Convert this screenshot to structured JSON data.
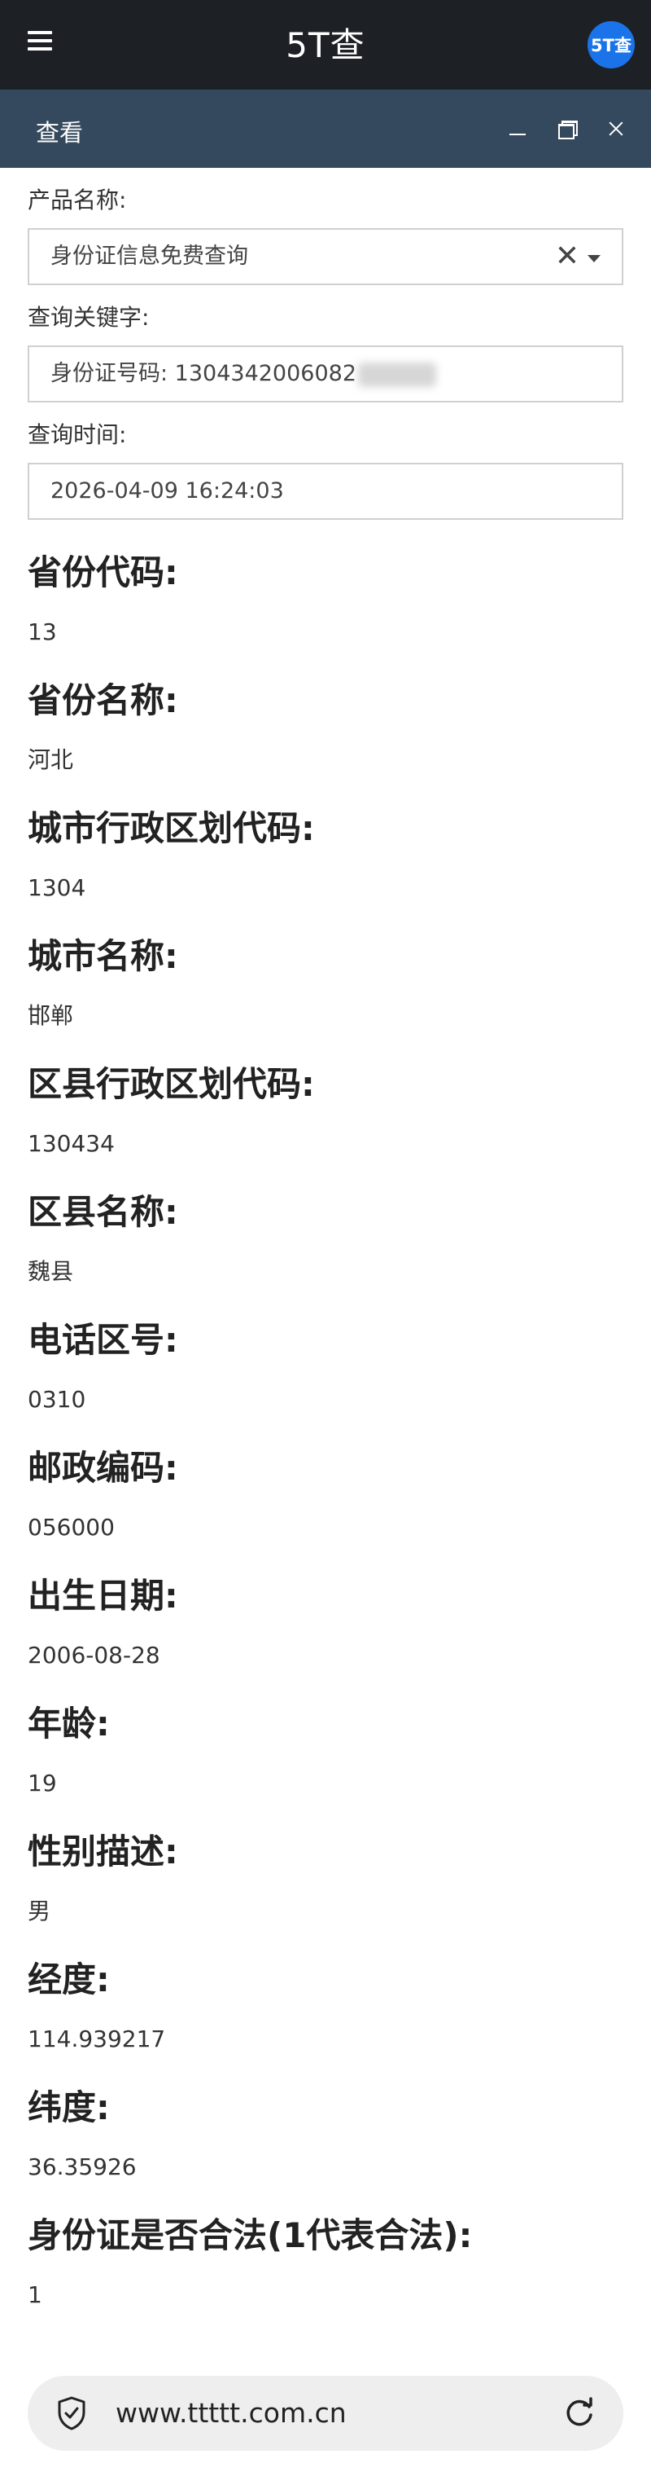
{
  "header": {
    "app_title": "5T查",
    "logo_text": "5T查",
    "menu_icon": "hamburger-menu-icon"
  },
  "window": {
    "title": "查看",
    "controls": [
      "minimize-icon",
      "maximize-icon",
      "close-icon"
    ]
  },
  "form": {
    "product_label": "产品名称:",
    "product_value": "身份证信息免费查询",
    "keyword_label": "查询关键字:",
    "keyword_value": "身份证号码: 1304342006082",
    "time_label": "查询时间:",
    "time_value": "2026-04-09 16:24:03"
  },
  "results": [
    {
      "label": "省份代码:",
      "value": "13"
    },
    {
      "label": "省份名称:",
      "value": "河北"
    },
    {
      "label": "城市行政区划代码:",
      "value": "1304"
    },
    {
      "label": "城市名称:",
      "value": "邯郸"
    },
    {
      "label": "区县行政区划代码:",
      "value": "130434"
    },
    {
      "label": "区县名称:",
      "value": "魏县"
    },
    {
      "label": "电话区号:",
      "value": "0310"
    },
    {
      "label": "邮政编码:",
      "value": "056000"
    },
    {
      "label": "出生日期:",
      "value": "2006-08-28"
    },
    {
      "label": "年龄:",
      "value": "19"
    },
    {
      "label": "性别描述:",
      "value": "男"
    },
    {
      "label": "经度:",
      "value": "114.939217"
    },
    {
      "label": "纬度:",
      "value": "36.35926"
    },
    {
      "label": "身份证是否合法(1代表合法):",
      "value": "1"
    }
  ],
  "browser": {
    "url": "www.ttttt.com.cn",
    "icons": [
      "shield-icon",
      "reload-icon"
    ]
  },
  "colors": {
    "topbar_bg": "#1d2126",
    "windowbar_bg": "#34495e",
    "logo_bg": "#1a73e8"
  }
}
